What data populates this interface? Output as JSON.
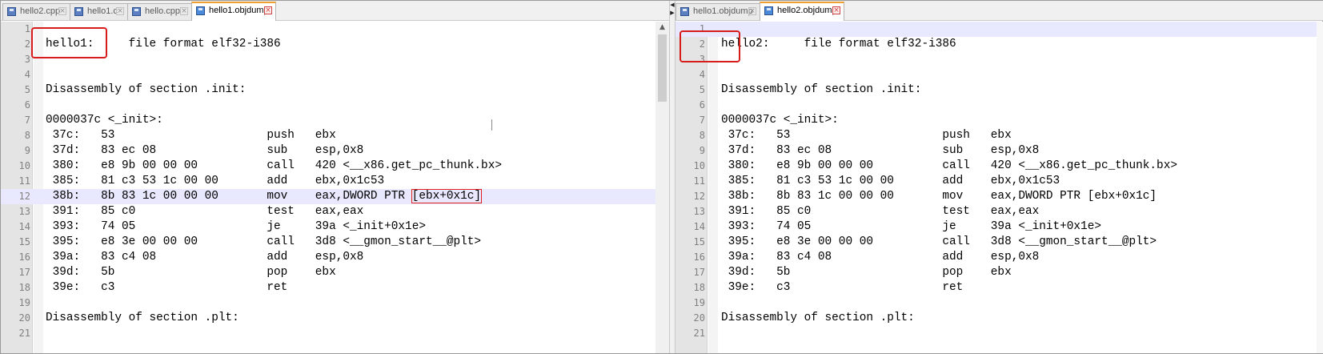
{
  "left_pane": {
    "tabs": [
      {
        "label": "hello2.cpp",
        "active": false
      },
      {
        "label": "hello1.c",
        "active": false
      },
      {
        "label": "hello.cpp",
        "active": false
      },
      {
        "label": "hello1.objdump",
        "active": true
      }
    ],
    "highlighted_line": 12,
    "lines": [
      {
        "num": "1",
        "text": ""
      },
      {
        "num": "2",
        "text": "hello1:     file format elf32-i386"
      },
      {
        "num": "3",
        "text": ""
      },
      {
        "num": "4",
        "text": ""
      },
      {
        "num": "5",
        "text": "Disassembly of section .init:"
      },
      {
        "num": "6",
        "text": ""
      },
      {
        "num": "7",
        "text": "0000037c <_init>:"
      },
      {
        "num": "8",
        "text": " 37c:   53                      push   ebx"
      },
      {
        "num": "9",
        "text": " 37d:   83 ec 08                sub    esp,0x8"
      },
      {
        "num": "10",
        "text": " 380:   e8 9b 00 00 00          call   420 <__x86.get_pc_thunk.bx>"
      },
      {
        "num": "11",
        "text": " 385:   81 c3 53 1c 00 00       add    ebx,0x1c53"
      },
      {
        "num": "12",
        "text": " 38b:   8b 83 1c 00 00 00       mov    eax,DWORD PTR ",
        "mark": "[ebx+0x1c]"
      },
      {
        "num": "13",
        "text": " 391:   85 c0                   test   eax,eax"
      },
      {
        "num": "14",
        "text": " 393:   74 05                   je     39a <_init+0x1e>"
      },
      {
        "num": "15",
        "text": " 395:   e8 3e 00 00 00          call   3d8 <__gmon_start__@plt>"
      },
      {
        "num": "16",
        "text": " 39a:   83 c4 08                add    esp,0x8"
      },
      {
        "num": "17",
        "text": " 39d:   5b                      pop    ebx"
      },
      {
        "num": "18",
        "text": " 39e:   c3                      ret"
      },
      {
        "num": "19",
        "text": ""
      },
      {
        "num": "20",
        "text": "Disassembly of section .plt:"
      },
      {
        "num": "21",
        "text": ""
      }
    ]
  },
  "right_pane": {
    "tabs": [
      {
        "label": "hello1.objdump",
        "active": false
      },
      {
        "label": "hello2.objdump",
        "active": true
      }
    ],
    "highlighted_line": 1,
    "lines": [
      {
        "num": "1",
        "text": ""
      },
      {
        "num": "2",
        "text": "hello2:     file format elf32-i386"
      },
      {
        "num": "3",
        "text": ""
      },
      {
        "num": "4",
        "text": ""
      },
      {
        "num": "5",
        "text": "Disassembly of section .init:"
      },
      {
        "num": "6",
        "text": ""
      },
      {
        "num": "7",
        "text": "0000037c <_init>:"
      },
      {
        "num": "8",
        "text": " 37c:   53                      push   ebx"
      },
      {
        "num": "9",
        "text": " 37d:   83 ec 08                sub    esp,0x8"
      },
      {
        "num": "10",
        "text": " 380:   e8 9b 00 00 00          call   420 <__x86.get_pc_thunk.bx>"
      },
      {
        "num": "11",
        "text": " 385:   81 c3 53 1c 00 00       add    ebx,0x1c53"
      },
      {
        "num": "12",
        "text": " 38b:   8b 83 1c 00 00 00       mov    eax,DWORD PTR [ebx+0x1c]"
      },
      {
        "num": "13",
        "text": " 391:   85 c0                   test   eax,eax"
      },
      {
        "num": "14",
        "text": " 393:   74 05                   je     39a <_init+0x1e>"
      },
      {
        "num": "15",
        "text": " 395:   e8 3e 00 00 00          call   3d8 <__gmon_start__@plt>"
      },
      {
        "num": "16",
        "text": " 39a:   83 c4 08                add    esp,0x8"
      },
      {
        "num": "17",
        "text": " 39d:   5b                      pop    ebx"
      },
      {
        "num": "18",
        "text": " 39e:   c3                      ret"
      },
      {
        "num": "19",
        "text": ""
      },
      {
        "num": "20",
        "text": "Disassembly of section .plt:"
      },
      {
        "num": "21",
        "text": ""
      }
    ]
  },
  "colors": {
    "highlight_line": "#e8e8ff",
    "annotation_red": "#d81b1b",
    "active_tab_accent": "#f0a030"
  },
  "icons": {
    "tab_file": "file-icon",
    "tab_close": "close-icon",
    "scroll_up": "chevron-up-icon",
    "divider_left": "arrow-left-icon",
    "divider_right": "arrow-right-icon"
  }
}
